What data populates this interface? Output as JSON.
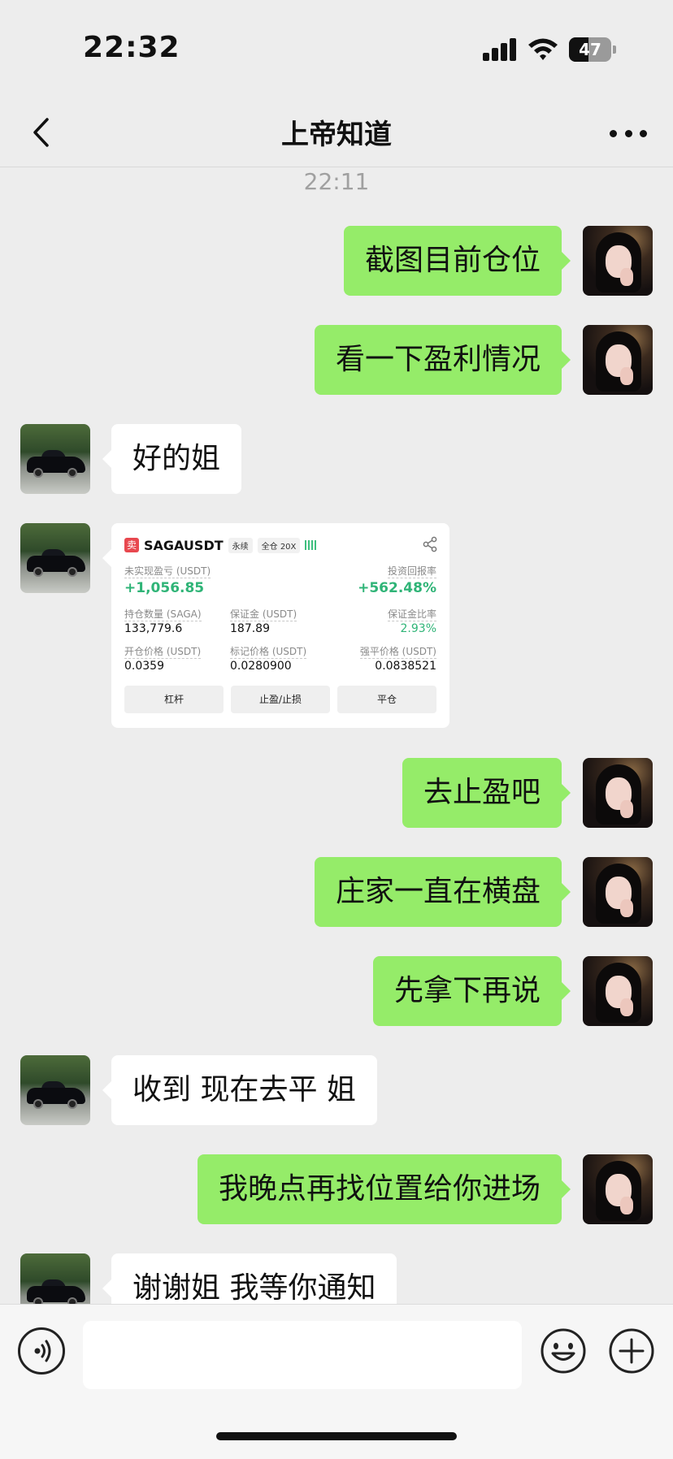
{
  "status_bar": {
    "time": "22:32",
    "battery": "47",
    "battery_level": 0.47
  },
  "nav": {
    "title": "上帝知道"
  },
  "chat": {
    "timestamp": "22:11",
    "messages": [
      {
        "side": "out",
        "text": "截图目前仓位"
      },
      {
        "side": "out",
        "text": "看一下盈利情况"
      },
      {
        "side": "in",
        "text": "好的姐"
      },
      {
        "side": "out",
        "text": "去止盈吧"
      },
      {
        "side": "out",
        "text": "庄家一直在横盘"
      },
      {
        "side": "out",
        "text": "先拿下再说"
      },
      {
        "side": "in",
        "text": "收到 现在去平 姐"
      },
      {
        "side": "out",
        "text": "我晚点再找位置给你进场"
      },
      {
        "side": "in",
        "text": "谢谢姐 我等你通知"
      }
    ],
    "trade_card": {
      "badge": "卖",
      "pair": "SAGAUSDT",
      "tag_perpetual": "永续",
      "tag_margin": "全仓 20X",
      "unrealized_pnl_label": "未实现盈亏 (USDT)",
      "unrealized_pnl": "+1,056.85",
      "roi_label": "投资回报率",
      "roi": "+562.48%",
      "position_size_label": "持仓数量 (SAGA)",
      "position_size": "133,779.6",
      "margin_label": "保证金 (USDT)",
      "margin": "187.89",
      "margin_ratio_label": "保证金比率",
      "margin_ratio": "2.93%",
      "entry_price_label": "开仓价格 (USDT)",
      "entry_price": "0.0359",
      "mark_price_label": "标记价格 (USDT)",
      "mark_price": "0.0280900",
      "liq_price_label": "强平价格 (USDT)",
      "liq_price": "0.0838521",
      "buttons": [
        "杠杆",
        "止盈/止损",
        "平仓"
      ]
    }
  },
  "colors": {
    "outgoing_bubble": "#95ec69",
    "incoming_bubble": "#ffffff",
    "background": "#ededed",
    "profit_green": "#2fb477"
  }
}
